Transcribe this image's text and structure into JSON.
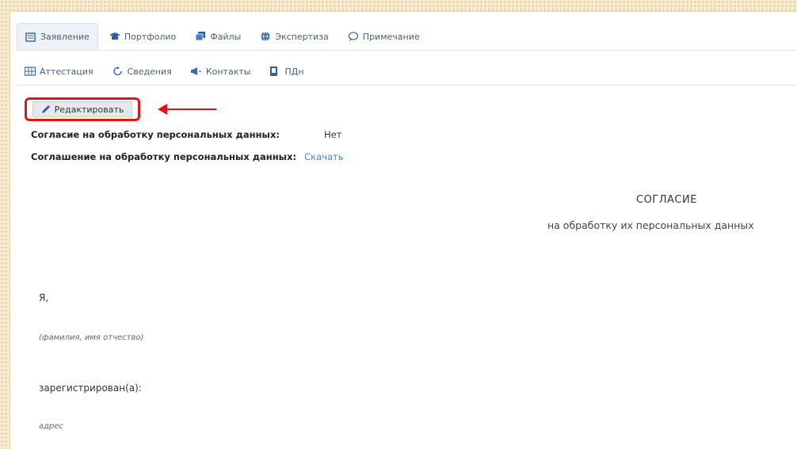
{
  "tabs_row1": [
    {
      "label": "Заявление",
      "icon": "form-icon",
      "active": true
    },
    {
      "label": "Портфолио",
      "icon": "graduation-cap-icon",
      "active": false
    },
    {
      "label": "Файлы",
      "icon": "files-icon",
      "active": false
    },
    {
      "label": "Экспертиза",
      "icon": "globe-icon",
      "active": false
    },
    {
      "label": "Примечание",
      "icon": "comment-icon",
      "active": false
    }
  ],
  "tabs_row2": [
    {
      "label": "Аттестация",
      "icon": "table-icon"
    },
    {
      "label": "Сведения",
      "icon": "refresh-icon"
    },
    {
      "label": "Контакты",
      "icon": "megaphone-icon"
    },
    {
      "label": "ПДн",
      "icon": "shield-icon"
    }
  ],
  "toolbar": {
    "edit_label": "Редактировать"
  },
  "fields": {
    "consent_label": "Согласие на обработку персональных данных:",
    "consent_value": "Нет",
    "agreement_label": "Соглашение на обработку персональных данных:",
    "agreement_link": "Скачать"
  },
  "document": {
    "title": "СОГЛАСИЕ",
    "subtitle": "на обработку их персональных данных",
    "line_i": "Я,",
    "line_fio": "(фамилия, имя отчество)",
    "line_registered": "зарегистрирован(а):",
    "line_address": "адрес"
  },
  "colors": {
    "highlight": "#e01616",
    "link": "#4b87c8",
    "tab_text": "#4a607c"
  }
}
